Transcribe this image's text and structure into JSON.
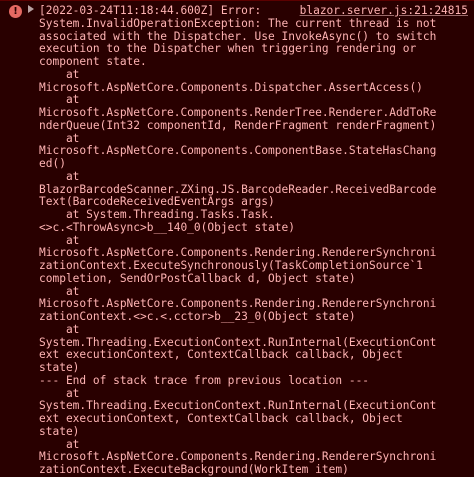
{
  "console": {
    "level_icon": "error-circle-icon",
    "expand_icon": "triangle-right-icon",
    "source": "blazor.server.js:21:24815",
    "lines": [
      "[2022-03-24T11:18:44.600Z] Error:",
      "System.InvalidOperationException: The current thread is not",
      "associated with the Dispatcher. Use InvokeAsync() to switch",
      "execution to the Dispatcher when triggering rendering or",
      "component state.",
      "    at",
      "Microsoft.AspNetCore.Components.Dispatcher.AssertAccess()",
      "    at",
      "Microsoft.AspNetCore.Components.RenderTree.Renderer.AddToRe",
      "nderQueue(Int32 componentId, RenderFragment renderFragment)",
      "    at",
      "Microsoft.AspNetCore.Components.ComponentBase.StateHasChang",
      "ed()",
      "    at",
      "BlazorBarcodeScanner.ZXing.JS.BarcodeReader.ReceivedBarcode",
      "Text(BarcodeReceivedEventArgs args)",
      "    at System.Threading.Tasks.Task.",
      "<>c.<ThrowAsync>b__140_0(Object state)",
      "    at",
      "Microsoft.AspNetCore.Components.Rendering.RendererSynchroni",
      "zationContext.ExecuteSynchronously(TaskCompletionSource`1",
      "completion, SendOrPostCallback d, Object state)",
      "    at",
      "Microsoft.AspNetCore.Components.Rendering.RendererSynchroni",
      "zationContext.<>c.<.cctor>b__23_0(Object state)",
      "    at",
      "System.Threading.ExecutionContext.RunInternal(ExecutionCont",
      "ext executionContext, ContextCallback callback, Object",
      "state)",
      "--- End of stack trace from previous location ---",
      "    at",
      "System.Threading.ExecutionContext.RunInternal(ExecutionCont",
      "ext executionContext, ContextCallback callback, Object",
      "state)",
      "    at",
      "Microsoft.AspNetCore.Components.Rendering.RendererSynchroni",
      "zationContext.ExecuteBackground(WorkItem item)"
    ]
  },
  "colors": {
    "background": "#290000",
    "text": "#ffb3b3",
    "error_icon": "#e46962"
  }
}
